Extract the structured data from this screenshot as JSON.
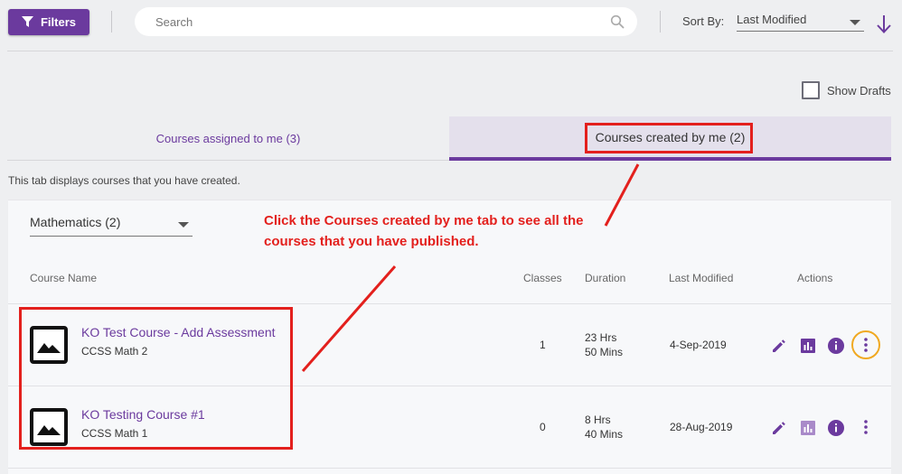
{
  "toolbar": {
    "filters_label": "Filters",
    "search_placeholder": "Search",
    "sort_by_label": "Sort By:",
    "sort_value": "Last Modified"
  },
  "show_drafts_label": "Show Drafts",
  "tabs": [
    {
      "label": "Courses assigned to me (3)",
      "active": false
    },
    {
      "label": "Courses created by me (2)",
      "active": true
    }
  ],
  "tab_description": "This tab displays courses that you have created.",
  "subject_filter": "Mathematics (2)",
  "columns": {
    "course_name": "Course Name",
    "classes": "Classes",
    "duration": "Duration",
    "last_modified": "Last Modified",
    "actions": "Actions"
  },
  "courses": [
    {
      "title": "KO Test Course - Add Assessment",
      "subtitle": "CCSS Math 2",
      "classes": "1",
      "duration_hrs": "23 Hrs",
      "duration_mins": "50 Mins",
      "last_modified": "4-Sep-2019"
    },
    {
      "title": "KO Testing Course #1",
      "subtitle": "CCSS Math 1",
      "classes": "0",
      "duration_hrs": "8 Hrs",
      "duration_mins": "40 Mins",
      "last_modified": "28-Aug-2019"
    }
  ],
  "annotation": {
    "line1": "Click the Courses created by me tab to see all the",
    "line2": "courses that you have published."
  },
  "colors": {
    "brand_purple": "#6b3a9e",
    "highlight_red": "#e3201d",
    "focus_orange": "#f0a922"
  }
}
